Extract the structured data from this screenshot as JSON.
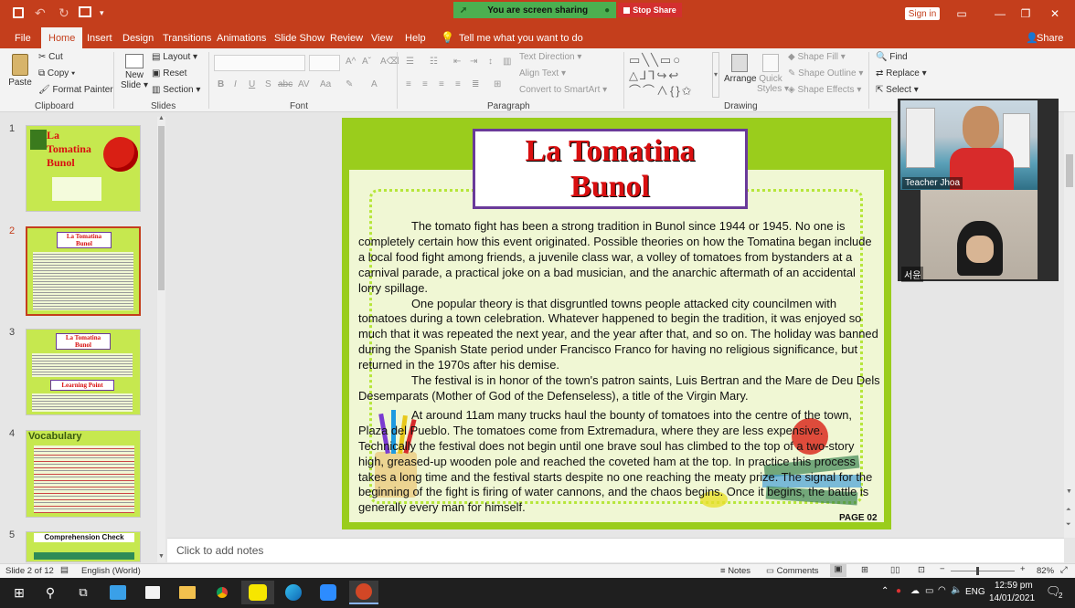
{
  "titlebar": {
    "share_banner": "You are screen sharing",
    "stop_share": "Stop Share",
    "sign_in": "Sign in"
  },
  "menu": {
    "file": "File",
    "tabs": [
      "Home",
      "Insert",
      "Design",
      "Transitions",
      "Animations",
      "Slide Show",
      "Review",
      "View",
      "Help"
    ],
    "tell_me": "Tell me what you want to do",
    "share": "Share"
  },
  "ribbon": {
    "clipboard": {
      "paste": "Paste",
      "cut": "Cut",
      "copy": "Copy",
      "format_painter": "Format Painter",
      "label": "Clipboard"
    },
    "slides": {
      "new_slide_line1": "New",
      "new_slide_line2": "Slide",
      "layout": "Layout",
      "reset": "Reset",
      "section": "Section",
      "label": "Slides"
    },
    "font": {
      "label": "Font"
    },
    "paragraph": {
      "text_direction": "Text Direction",
      "align_text": "Align Text",
      "convert_smartart": "Convert to SmartArt",
      "label": "Paragraph"
    },
    "drawing": {
      "arrange": "Arrange",
      "quick_styles_line1": "Quick",
      "quick_styles_line2": "Styles",
      "shape_fill": "Shape Fill",
      "shape_outline": "Shape Outline",
      "shape_effects": "Shape Effects",
      "label": "Drawing"
    },
    "editing": {
      "find": "Find",
      "replace": "Replace",
      "select": "Select"
    }
  },
  "thumbnails": [
    {
      "num": "1",
      "title_line1": "La",
      "title_line2": "Tomatina",
      "title_line3": "Bunol"
    },
    {
      "num": "2",
      "title_line1": "La Tomatina",
      "title_line2": "Bunol"
    },
    {
      "num": "3",
      "title_line1": "La Tomatina",
      "title_line2": "Bunol",
      "sub": "Learning Point"
    },
    {
      "num": "4",
      "title_line1": "Vocabulary"
    },
    {
      "num": "5",
      "title_line1": "Comprehension Check"
    }
  ],
  "slide": {
    "title_line1": "La Tomatina",
    "title_line2": "Bunol",
    "paragraphs": [
      "The tomato fight has been a strong tradition in Bunol since 1944 or 1945. No one is completely certain how this event originated. Possible theories on how the Tomatina began include a local food fight among friends, a juvenile class war, a volley of tomatoes from bystanders at a carnival parade, a practical joke on a bad musician, and the anarchic aftermath of an accidental lorry spillage.",
      "One popular theory is that disgruntled towns people attacked city councilmen with tomatoes during a town celebration. Whatever happened to begin the tradition, it was enjoyed so much that it was repeated the next year, and the year after that, and so on. The holiday was banned during the Spanish State period under Francisco Franco for having no religious significance, but returned in the 1970s after his demise.",
      "The festival is in honor of the town's patron saints, Luis Bertran and the Mare de Deu Dels Desemparats (Mother of God of the Defenseless), a title of the Virgin Mary.",
      "At around 11am many trucks haul the bounty of tomatoes into the centre of the town, Plaza del Pueblo. The tomatoes come from Extremadura, where they are less expensive. Technically the festival does not begin until one brave soul has climbed to the top of a two-story high, greased-up wooden pole and reached the coveted ham at the top. In practice this process takes a long time and the festival starts despite no one reaching the meaty prize. The signal for the beginning of the fight is firing of water cannons, and the chaos begins. Once it begins, the battle is generally every man for himself."
    ],
    "page_label": "PAGE 02"
  },
  "notes_placeholder": "Click to add notes",
  "video": {
    "participant1": "Teacher Jhoa",
    "participant2": "서윤"
  },
  "status": {
    "slide_info": "Slide 2 of 12",
    "language": "English (World)",
    "notes": "Notes",
    "comments": "Comments",
    "zoom": "82%"
  },
  "taskbar": {
    "lang": "ENG",
    "time": "12:59 pm",
    "date": "14/01/2021",
    "notif_count": "2"
  }
}
